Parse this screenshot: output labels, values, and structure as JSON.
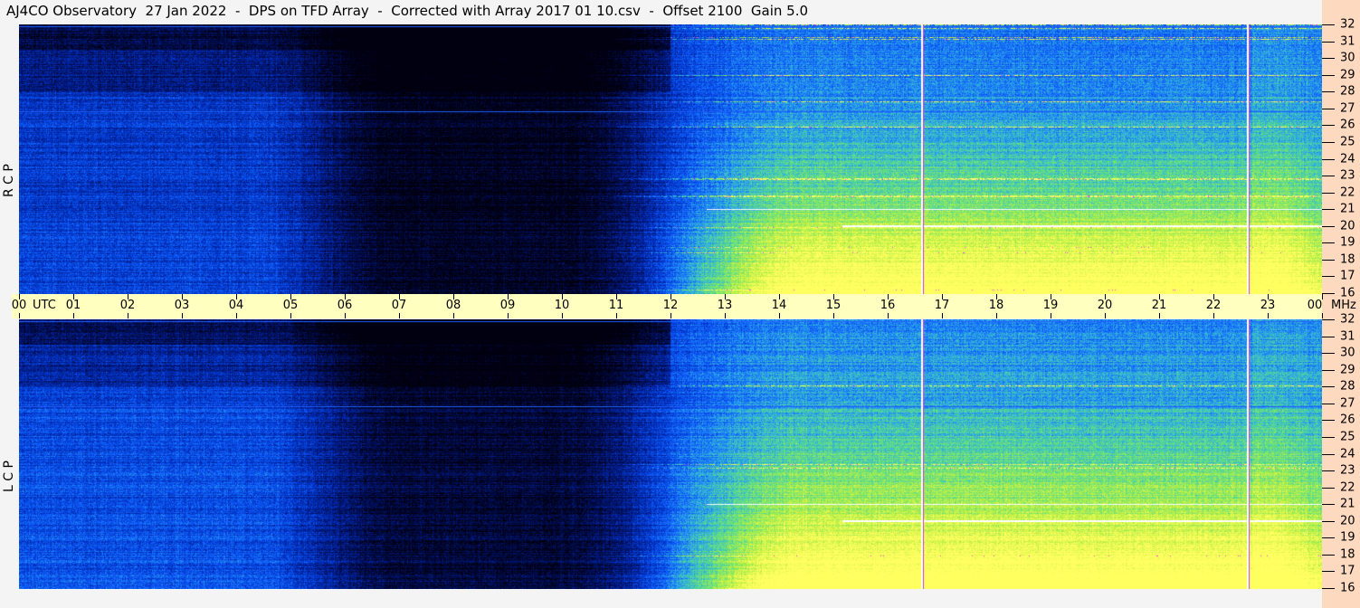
{
  "title": "AJ4CO Observatory  27 Jan 2022  -  DPS on TFD Array  -  Corrected with Array 2017 01 10.csv  -  Offset 2100  Gain 5.0",
  "chart_data": [
    {
      "type": "heatmap",
      "panel_label": "R C P",
      "x_unit": "UTC",
      "y_unit": "MHz",
      "x_ticks": [
        "00",
        "01",
        "02",
        "03",
        "04",
        "05",
        "06",
        "07",
        "08",
        "09",
        "10",
        "11",
        "12",
        "13",
        "14",
        "15",
        "16",
        "17",
        "18",
        "19",
        "20",
        "21",
        "22",
        "23",
        "00"
      ],
      "y_ticks": [
        "32",
        "31",
        "30",
        "29",
        "28",
        "27",
        "26",
        "25",
        "24",
        "23",
        "22",
        "21",
        "20",
        "19",
        "18",
        "17",
        "16"
      ],
      "xlim_hours": [
        0,
        24
      ],
      "ylim_mhz": [
        16,
        32
      ],
      "colormap": [
        "#000010",
        "#001060",
        "#0030c0",
        "#1060ff",
        "#30b0e0",
        "#60e080",
        "#c0f040",
        "#ffff60"
      ]
    },
    {
      "type": "heatmap",
      "panel_label": "L C P",
      "x_unit": "UTC",
      "y_unit": "MHz",
      "x_ticks": [
        "00",
        "01",
        "02",
        "03",
        "04",
        "05",
        "06",
        "07",
        "08",
        "09",
        "10",
        "11",
        "12",
        "13",
        "14",
        "15",
        "16",
        "17",
        "18",
        "19",
        "20",
        "21",
        "22",
        "23",
        "00"
      ],
      "y_ticks": [
        "32",
        "31",
        "30",
        "29",
        "28",
        "27",
        "26",
        "25",
        "24",
        "23",
        "22",
        "21",
        "20",
        "19",
        "18",
        "17",
        "16"
      ],
      "xlim_hours": [
        0,
        24
      ],
      "ylim_mhz": [
        16,
        32
      ],
      "colormap": [
        "#000010",
        "#001060",
        "#0030c0",
        "#1060ff",
        "#30b0e0",
        "#60e080",
        "#c0f040",
        "#ffff60"
      ]
    }
  ],
  "colors": {
    "axis_band": "#ffffc0",
    "right_strip": "#fdd9bf",
    "background": "#f4f4f4"
  }
}
